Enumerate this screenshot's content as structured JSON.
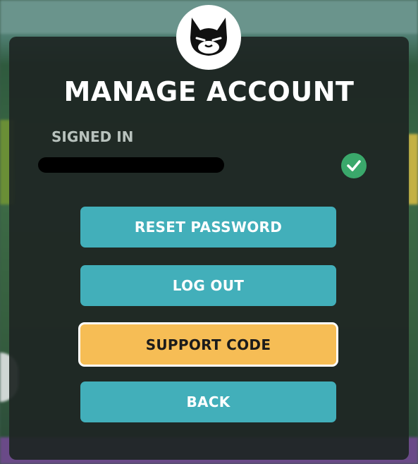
{
  "dialog": {
    "title": "MANAGE ACCOUNT",
    "signed_in_label": "SIGNED IN",
    "account_status_icon": "check-icon",
    "logo_icon": "cat-logo-icon"
  },
  "buttons": {
    "reset_password": "RESET PASSWORD",
    "log_out": "LOG OUT",
    "support_code": "SUPPORT CODE",
    "back": "BACK"
  },
  "colors": {
    "primary_button": "#42afba",
    "highlight_button": "#f6bd55",
    "status_green": "#3aa86b"
  }
}
